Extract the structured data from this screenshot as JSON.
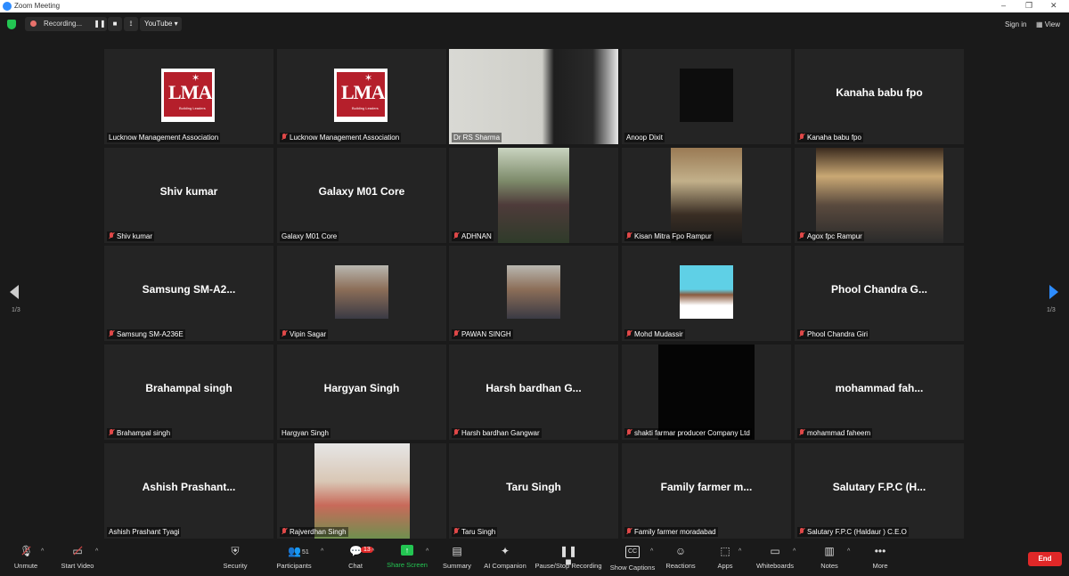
{
  "window": {
    "title": "Zoom Meeting"
  },
  "topbar": {
    "recording_label": "Recording...",
    "youtube_label": "YouTube ▾",
    "sign_in": "Sign in",
    "view": "View"
  },
  "pagination": {
    "left": "1/3",
    "right": "1/3"
  },
  "tiles": [
    {
      "row": 0,
      "col": 0,
      "name": "Lucknow Management Association",
      "display": "",
      "muted": false,
      "kind": "logo"
    },
    {
      "row": 0,
      "col": 1,
      "name": "Lucknow Management Association",
      "display": "",
      "muted": true,
      "kind": "logo"
    },
    {
      "row": 0,
      "col": 2,
      "name": "Dr RS Sharma",
      "display": "",
      "muted": false,
      "kind": "video",
      "active": true
    },
    {
      "row": 0,
      "col": 3,
      "name": "Anoop Dixit",
      "display": "",
      "muted": false,
      "kind": "dark"
    },
    {
      "row": 0,
      "col": 4,
      "name": "Kanaha babu fpo",
      "display": "Kanaha babu fpo",
      "muted": true,
      "kind": "text"
    },
    {
      "row": 1,
      "col": 0,
      "name": "Shiv kumar",
      "display": "Shiv kumar",
      "muted": true,
      "kind": "text"
    },
    {
      "row": 1,
      "col": 1,
      "name": "Galaxy M01 Core",
      "display": "Galaxy M01 Core",
      "muted": false,
      "kind": "text"
    },
    {
      "row": 1,
      "col": 2,
      "name": "ADHNAN",
      "display": "",
      "muted": true,
      "kind": "video"
    },
    {
      "row": 1,
      "col": 3,
      "name": "Kisan Mitra Fpo Rampur",
      "display": "",
      "muted": true,
      "kind": "video"
    },
    {
      "row": 1,
      "col": 4,
      "name": "Agox fpc Rampur",
      "display": "",
      "muted": true,
      "kind": "video"
    },
    {
      "row": 2,
      "col": 0,
      "name": "Samsung SM-A236E",
      "display": "Samsung  SM-A2...",
      "muted": true,
      "kind": "text"
    },
    {
      "row": 2,
      "col": 1,
      "name": "Vipin Sagar",
      "display": "",
      "muted": true,
      "kind": "photo"
    },
    {
      "row": 2,
      "col": 2,
      "name": "PAWAN SINGH",
      "display": "",
      "muted": true,
      "kind": "photo"
    },
    {
      "row": 2,
      "col": 3,
      "name": "Mohd Mudassir",
      "display": "",
      "muted": true,
      "kind": "photo"
    },
    {
      "row": 2,
      "col": 4,
      "name": "Phool Chandra Giri",
      "display": "Phool Chandra G...",
      "muted": true,
      "kind": "text"
    },
    {
      "row": 3,
      "col": 0,
      "name": "Brahampal singh",
      "display": "Brahampal singh",
      "muted": true,
      "kind": "text"
    },
    {
      "row": 3,
      "col": 1,
      "name": "Hargyan Singh",
      "display": "Hargyan Singh",
      "muted": false,
      "kind": "text"
    },
    {
      "row": 3,
      "col": 2,
      "name": "Harsh bardhan Gangwar",
      "display": "Harsh bardhan G...",
      "muted": true,
      "kind": "text"
    },
    {
      "row": 3,
      "col": 3,
      "name": "shakti farmar producer Company Ltd",
      "display": "",
      "muted": true,
      "kind": "black"
    },
    {
      "row": 3,
      "col": 4,
      "name": "mohammad faheem",
      "display": "mohammad  fah...",
      "muted": true,
      "kind": "text"
    },
    {
      "row": 4,
      "col": 0,
      "name": "Ashish Prashant Tyagi",
      "display": "Ashish  Prashant...",
      "muted": false,
      "kind": "text"
    },
    {
      "row": 4,
      "col": 1,
      "name": "Rajverdhan Singh",
      "display": "",
      "muted": true,
      "kind": "photo"
    },
    {
      "row": 4,
      "col": 2,
      "name": "Taru Singh",
      "display": "Taru Singh",
      "muted": true,
      "kind": "text"
    },
    {
      "row": 4,
      "col": 3,
      "name": "Family farmer moradabad",
      "display": "Family  farmer  m...",
      "muted": true,
      "kind": "text"
    },
    {
      "row": 4,
      "col": 4,
      "name": "Salutary F.P.C (Haldaur ) C.E.O",
      "display": "Salutary  F.P.C  (H...",
      "muted": true,
      "kind": "text"
    }
  ],
  "logo": {
    "text": "LMA",
    "subtitle": "Building Leaders"
  },
  "toolbar": {
    "unmute": "Unmute",
    "start_video": "Start Video",
    "security": "Security",
    "participants": "Participants",
    "participants_count": "51",
    "chat": "Chat",
    "chat_badge": "13",
    "share_screen": "Share Screen",
    "summary": "Summary",
    "ai_companion": "AI Companion",
    "pause_stop_recording": "Pause/Stop Recording",
    "show_captions": "Show Captions",
    "reactions": "Reactions",
    "apps": "Apps",
    "whiteboards": "Whiteboards",
    "notes": "Notes",
    "more": "More",
    "end": "End"
  },
  "colors": {
    "accent_blue": "#2d8cff",
    "active_speaker": "#c4e35a",
    "end_red": "#e02828",
    "share_green": "#23c552"
  }
}
